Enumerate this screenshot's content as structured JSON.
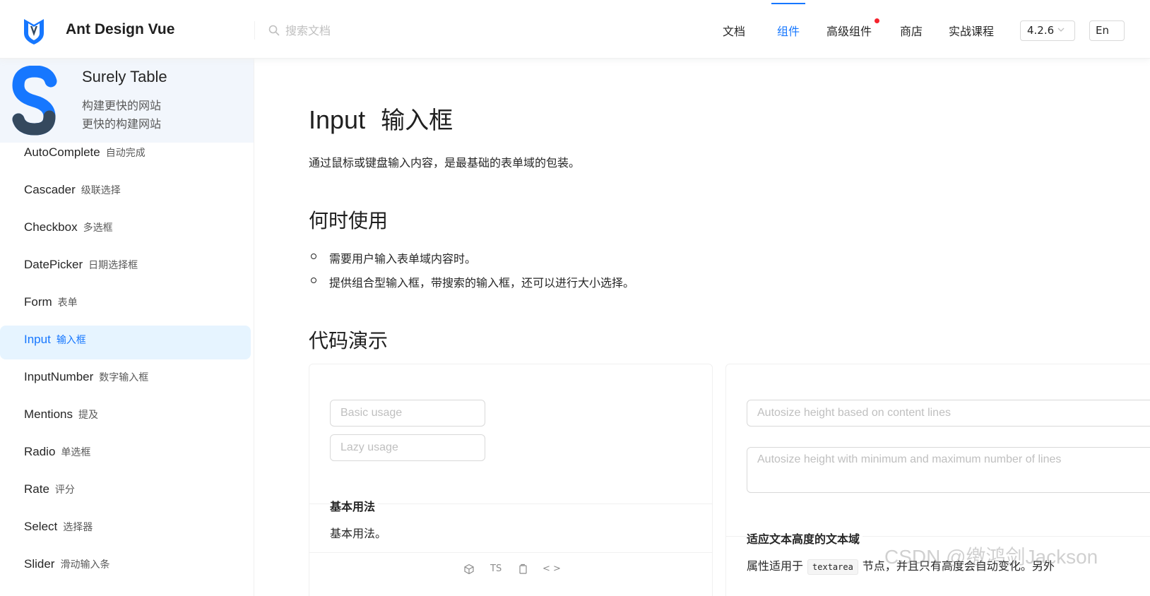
{
  "header": {
    "brand": "Ant Design Vue",
    "search_placeholder": "搜索文档",
    "nav": [
      {
        "label": "文档",
        "active": false
      },
      {
        "label": "组件",
        "active": true
      },
      {
        "label": "高级组件",
        "active": false,
        "badge_dot": true
      },
      {
        "label": "商店",
        "active": false
      },
      {
        "label": "实战课程",
        "active": false
      }
    ],
    "version": "4.2.6",
    "language": "En"
  },
  "sidebar": {
    "promo": {
      "title": "Surely Table",
      "lines": [
        "构建更快的网站",
        "更快的构建网站"
      ]
    },
    "items": [
      {
        "en": "AutoComplete",
        "zh": "自动完成",
        "active": false
      },
      {
        "en": "Cascader",
        "zh": "级联选择",
        "active": false
      },
      {
        "en": "Checkbox",
        "zh": "多选框",
        "active": false
      },
      {
        "en": "DatePicker",
        "zh": "日期选择框",
        "active": false
      },
      {
        "en": "Form",
        "zh": "表单",
        "active": false
      },
      {
        "en": "Input",
        "zh": "输入框",
        "active": true
      },
      {
        "en": "InputNumber",
        "zh": "数字输入框",
        "active": false
      },
      {
        "en": "Mentions",
        "zh": "提及",
        "active": false
      },
      {
        "en": "Radio",
        "zh": "单选框",
        "active": false
      },
      {
        "en": "Rate",
        "zh": "评分",
        "active": false
      },
      {
        "en": "Select",
        "zh": "选择器",
        "active": false
      },
      {
        "en": "Slider",
        "zh": "滑动输入条",
        "active": false
      }
    ]
  },
  "main": {
    "title_en": "Input",
    "title_zh": "输入框",
    "description": "通过鼠标或键盘输入内容，是最基础的表单域的包装。",
    "when_title": "何时使用",
    "when_items": [
      "需要用户输入表单域内容时。",
      "提供组合型输入框，带搜索的输入框，还可以进行大小选择。"
    ],
    "demo_title": "代码演示",
    "demo_basic": {
      "input1_placeholder": "Basic usage",
      "input2_placeholder": "Lazy usage",
      "title": "基本用法",
      "description": "基本用法。",
      "actions": {
        "ts": "TS",
        "code": "< >"
      }
    },
    "demo_autosize": {
      "input1_placeholder": "Autosize height based on content lines",
      "input2_placeholder": "Autosize height with minimum and maximum number of lines",
      "title": "适应文本高度的文本域",
      "desc_before": "属性适用于",
      "desc_code": "textarea",
      "desc_after": "节点，并且只有高度会自动变化。另外"
    },
    "watermark": "CSDN @缴鸿剑Jackson"
  },
  "colors": {
    "primary": "#1677ff",
    "active_bg": "#e6f4ff",
    "promo_bg": "#f2f6fc",
    "badge_dot": "#f5222d"
  }
}
